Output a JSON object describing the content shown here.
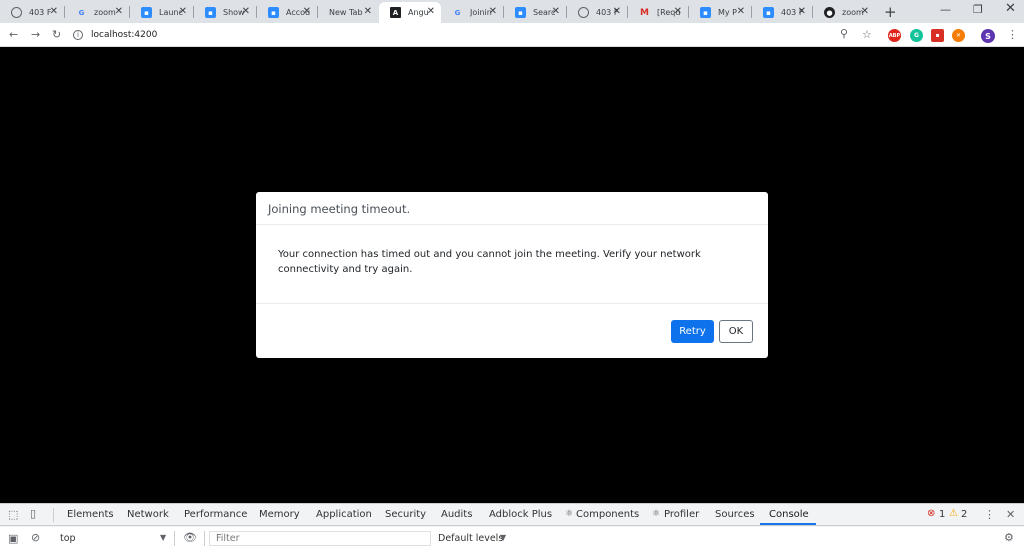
{
  "browser": {
    "tabs": [
      {
        "title": "403 F",
        "icon": "globe-icon"
      },
      {
        "title": "zoom",
        "icon": "google-icon"
      },
      {
        "title": "Launc",
        "icon": "zoom-icon"
      },
      {
        "title": "Show",
        "icon": "zoom-icon"
      },
      {
        "title": "Accou",
        "icon": "zoom-icon"
      },
      {
        "title": "New Tab",
        "icon": ""
      },
      {
        "title": "Angu",
        "icon": "angular-icon"
      },
      {
        "title": "Joinin",
        "icon": "google-icon"
      },
      {
        "title": "Searc",
        "icon": "zoom-icon"
      },
      {
        "title": "403 F",
        "icon": "globe-icon"
      },
      {
        "title": "[Requ",
        "icon": "gmail-icon"
      },
      {
        "title": "My P",
        "icon": "zoom-icon"
      },
      {
        "title": "403 F",
        "icon": "zoom-icon"
      },
      {
        "title": "zoom",
        "icon": "github-icon"
      }
    ],
    "url": "localhost:4200",
    "profile_initial": "S",
    "extensions": {
      "abp": "ABP",
      "grammarly": "G"
    }
  },
  "dialog": {
    "title": "Joining meeting timeout.",
    "message": "Your connection has timed out and you cannot join the meeting. Verify your network connectivity and try again.",
    "retry_label": "Retry",
    "ok_label": "OK"
  },
  "devtools": {
    "tabs": [
      "Elements",
      "Network",
      "Performance",
      "Memory",
      "Application",
      "Security",
      "Audits",
      "Adblock Plus",
      "Components",
      "Profiler",
      "Sources",
      "Console"
    ],
    "active_tab": "Console",
    "error_count": "1",
    "warning_count": "2",
    "context": "top",
    "filter_placeholder": "Filter",
    "levels": "Default levels"
  },
  "colors": {
    "primary": "#0e72ed",
    "backdrop": "#000000",
    "error": "#d93025",
    "warning": "#f9ab00"
  }
}
